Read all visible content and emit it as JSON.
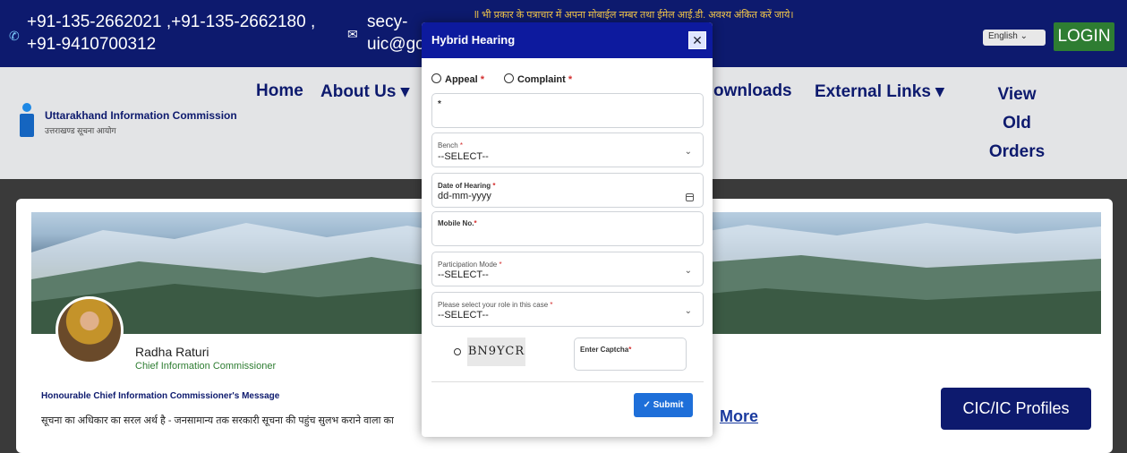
{
  "topbar": {
    "phone": "+91-135-2662021 ,+91-135-2662180 ,\n+91-9410700312",
    "email": "secy-\nuic@go",
    "ticker": "ll भी प्रकार के पत्राचार में अपना मोबाईल नम्बर तथा ईमेल आई.डी. अवश्य अंकित करें जाये।",
    "language": "English ⌄",
    "login": "LOGIN"
  },
  "org": {
    "name_en": "Uttarakhand Information Commission",
    "name_hi": "उत्तराखण्ड सूचना आयोग"
  },
  "nav": {
    "home": "Home",
    "about": "About Us ▾",
    "downloads": "ownloads",
    "external": "External Links ▾",
    "view_orders": "View Old Orders"
  },
  "commissioner": {
    "name": "Radha Raturi",
    "title": "Chief Information Commissioner",
    "message_heading": "Honourable Chief Information Commissioner's Message",
    "message_body": "सूचना का अधिकार का सरल अर्थ है - जनसामान्य तक सरकारी सूचना की पहुंच सुलभ कराने वाला का",
    "read_more": "More",
    "profiles_button": "CIC/IC Profiles"
  },
  "modal": {
    "title": "Hybrid Hearing",
    "close": "✕",
    "radio_appeal": "Appeal",
    "radio_complaint": "Complaint",
    "required_mark": "*",
    "bench_label": "Bench",
    "bench_value": "--SELECT--",
    "date_label": "Date of Hearing",
    "date_value": "dd-mm-yyyy",
    "mobile_label": "Mobile No.",
    "participation_label": "Participation Mode",
    "participation_value": "--SELECT--",
    "role_label": "Please select your role in this case",
    "role_value": "--SELECT--",
    "captcha_text": "BN9YCR",
    "captcha_label": "Enter Captcha",
    "submit": "✓ Submit"
  }
}
